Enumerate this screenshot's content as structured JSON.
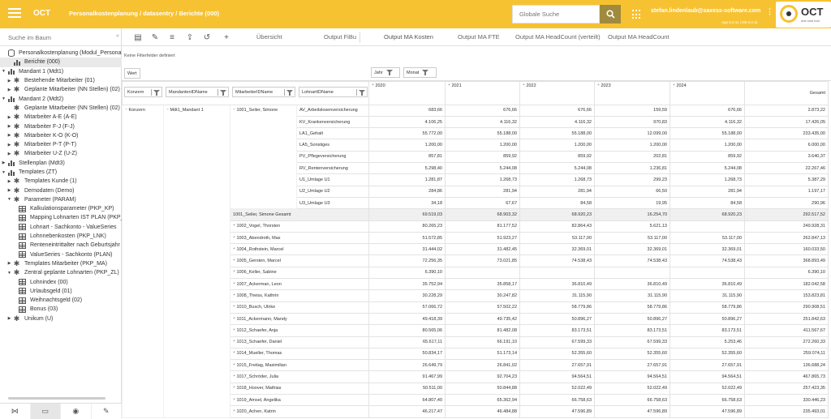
{
  "header": {
    "app_name": "OCT",
    "breadcrumb": "Personalkostenplanung / datasentry / Berichte (000)",
    "search_placeholder": "Globale Suche",
    "user": "stefan.lindenlaub@saxess-software.com",
    "version": "App 5.0.11 | DB 5.0.11",
    "logo_text": "OCT",
    "logo_tagline": "one cool tool",
    "accent_color": "#f7c232"
  },
  "left": {
    "search_placeholder": "Suche im Baum",
    "collapse_icon": "«",
    "tree": [
      {
        "label": "Personalkostenplanung (Modul_Personalkosten)",
        "icon": "database-icon",
        "caret": "",
        "indent": 0
      },
      {
        "label": "Berichte (000)",
        "icon": "bar-chart-icon",
        "caret": "",
        "indent": 1,
        "selected": true
      },
      {
        "label": "Mandant 1 (Mdt1)",
        "icon": "bar-chart-icon",
        "caret": "▼",
        "indent": 0
      },
      {
        "label": "Bestehende Mitarbeiter (01)",
        "icon": "gear-icon",
        "caret": "▶",
        "indent": 1
      },
      {
        "label": "Geplante Mitarbeiter (NN Stellen) (02)",
        "icon": "gear-icon",
        "caret": "▶",
        "indent": 1
      },
      {
        "label": "Mandant 2 (Mdt2)",
        "icon": "bar-chart-icon",
        "caret": "▼",
        "indent": 0
      },
      {
        "label": "Geplante Mitarbeiter (NN Stellen) (02)",
        "icon": "gear-icon",
        "caret": "",
        "indent": 1
      },
      {
        "label": "Mitarbeiter A-E (A-E)",
        "icon": "gear-icon",
        "caret": "▶",
        "indent": 1
      },
      {
        "label": "Mitarbeiter F-J (F-J)",
        "icon": "gear-icon",
        "caret": "▶",
        "indent": 1
      },
      {
        "label": "Mitarbeiter K-O (K-O)",
        "icon": "gear-icon",
        "caret": "▶",
        "indent": 1
      },
      {
        "label": "Mitarbeiter P-T (P-T)",
        "icon": "gear-icon",
        "caret": "▶",
        "indent": 1
      },
      {
        "label": "Mitarbeiter U-Z (U-Z)",
        "icon": "gear-icon",
        "caret": "▶",
        "indent": 1
      },
      {
        "label": "Stellenplan (Mdt3)",
        "icon": "bar-chart-icon",
        "caret": "▶",
        "indent": 0
      },
      {
        "label": "Templates (ZT)",
        "icon": "bar-chart-icon",
        "caret": "▼",
        "indent": 0
      },
      {
        "label": "Templates Kunde (1)",
        "icon": "gear-icon",
        "caret": "▶",
        "indent": 1
      },
      {
        "label": "Demodaten (Demo)",
        "icon": "gear-icon",
        "caret": "▶",
        "indent": 1
      },
      {
        "label": "Parameter (PARAM)",
        "icon": "gear-icon",
        "caret": "▼",
        "indent": 1
      },
      {
        "label": "Kalkulationsparameter (PKP_KP)",
        "icon": "table-icon",
        "caret": "",
        "indent": 2
      },
      {
        "label": "Mapping Lohnarten IST PLAN (PKP_MAP)",
        "icon": "table-icon",
        "caret": "",
        "indent": 2
      },
      {
        "label": "Lohnart - Sachkonto - ValueSeries",
        "icon": "table-icon",
        "caret": "",
        "indent": 2
      },
      {
        "label": "Lohnnebenkosten (PKP_LNK)",
        "icon": "table-icon",
        "caret": "",
        "indent": 2
      },
      {
        "label": "Renteneintrittalter nach Geburtsjahr",
        "icon": "table-icon",
        "caret": "",
        "indent": 2
      },
      {
        "label": "ValueSeries - Sachkonto (PLAN)",
        "icon": "table-icon",
        "caret": "",
        "indent": 2
      },
      {
        "label": "Templates Mitarbeiter (PKP_MA)",
        "icon": "gear-icon",
        "caret": "▶",
        "indent": 1
      },
      {
        "label": "Zentral geplante Lohnarten (PKP_ZL)",
        "icon": "gear-icon",
        "caret": "▼",
        "indent": 1
      },
      {
        "label": "Lohnindex (00)",
        "icon": "table-icon",
        "caret": "",
        "indent": 2
      },
      {
        "label": "Urlaubsgeld (01)",
        "icon": "table-icon",
        "caret": "",
        "indent": 2
      },
      {
        "label": "Weihnachtsgeld (02)",
        "icon": "table-icon",
        "caret": "",
        "indent": 2
      },
      {
        "label": "Bonus (03)",
        "icon": "table-icon",
        "caret": "",
        "indent": 2
      },
      {
        "label": "Unikum (U)",
        "icon": "gear-icon",
        "caret": "▶",
        "indent": 1
      }
    ],
    "bottom_tabs": [
      "share-icon",
      "dashboard-icon",
      "eye-icon",
      "wrench-icon"
    ]
  },
  "toolbar": {
    "tools": [
      "report-icon",
      "wrench-icon",
      "format-icon",
      "export-icon",
      "history-icon",
      "add-icon"
    ],
    "tabs": [
      "Übersicht",
      "Output FiBu",
      "Output MA Kosten",
      "Output MA FTE",
      "Output MA HeadCount (verteilt)",
      "Output MA HeadCount"
    ],
    "active_tab": "Output MA Kosten"
  },
  "filter": {
    "info": "Keine Filterfelder definiert",
    "data_chip": "Wert",
    "column_chips": [
      "Jahr",
      "Monat"
    ],
    "row_chips": [
      "Konzern",
      "MandantenIDName",
      "MitarbeiterIDName",
      "LohnartIDName"
    ]
  },
  "pivot": {
    "columns": [
      "2020",
      "2021",
      "2022",
      "2023",
      "2024",
      "Gesamt"
    ],
    "konzern": "Konzern",
    "mandant": "Mdt1_Mandant 1",
    "first_employee": "1001_Seiler, Simone",
    "detail_rows": [
      {
        "lohnart": "AV_Arbeitslosenversicherung",
        "values": [
          "683,66",
          "676,66",
          "676,66",
          "159,59",
          "676,66",
          "2.873,22"
        ]
      },
      {
        "lohnart": "KV_Krankenversicherung",
        "values": [
          "4.106,25",
          "4.116,32",
          "4.116,32",
          "970,83",
          "4.116,32",
          "17.426,05"
        ]
      },
      {
        "lohnart": "LA1_Gehalt",
        "values": [
          "55.772,00",
          "55.188,00",
          "55.188,00",
          "12.099,00",
          "55.188,00",
          "233.435,00"
        ]
      },
      {
        "lohnart": "LA5_Sonstiges",
        "values": [
          "1.200,00",
          "1.200,00",
          "1.200,00",
          "1.200,00",
          "1.200,00",
          "6.000,00"
        ]
      },
      {
        "lohnart": "PV_Pflegeversicherung",
        "values": [
          "857,81",
          "859,92",
          "859,92",
          "202,81",
          "859,92",
          "3.640,37"
        ]
      },
      {
        "lohnart": "RV_Rentenversicherung",
        "values": [
          "5.298,40",
          "5.244,08",
          "5.244,08",
          "1.236,81",
          "5.244,08",
          "22.267,46"
        ]
      },
      {
        "lohnart": "U1_Umlage U1",
        "values": [
          "1.281,87",
          "1.268,73",
          "1.268,73",
          "299,23",
          "1.268,73",
          "5.387,29"
        ]
      },
      {
        "lohnart": "U2_Umlage U2",
        "values": [
          "284,86",
          "281,94",
          "281,94",
          "66,50",
          "281,94",
          "1.197,17"
        ]
      },
      {
        "lohnart": "U3_Umlage U3",
        "values": [
          "34,18",
          "67,67",
          "84,58",
          "19,95",
          "84,58",
          "290,96"
        ]
      }
    ],
    "subtotal": {
      "label": "1001_Seiler, Simone Gesamt",
      "values": [
        "69.519,03",
        "68.903,32",
        "68.920,23",
        "16.254,70",
        "68.920,23",
        "292.517,52"
      ]
    },
    "employees": [
      {
        "label": "1002_Vogel, Thorsten",
        "values": [
          "80.265,23",
          "81.177,52",
          "82.864,43",
          "5.621,13",
          "",
          "249.928,31"
        ]
      },
      {
        "label": "1003_Abendroth, Max",
        "values": [
          "51.572,85",
          "51.923,27",
          "53.117,00",
          "53.117,00",
          "53.117,00",
          "262.847,13"
        ]
      },
      {
        "label": "1004_Rothstein, Marcel",
        "values": [
          "31.444,02",
          "31.482,45",
          "32.369,01",
          "32.369,01",
          "32.369,01",
          "160.033,50"
        ]
      },
      {
        "label": "1005_Gersten, Marcel",
        "values": [
          "72.256,35",
          "73.021,85",
          "74.538,43",
          "74.538,43",
          "74.538,43",
          "368.893,49"
        ]
      },
      {
        "label": "1006_Keller, Sabine",
        "values": [
          "6.390,10",
          "",
          "",
          "",
          "",
          "6.390,10"
        ]
      },
      {
        "label": "1007_Ackerman, Leon",
        "values": [
          "35.752,94",
          "35.858,17",
          "36.810,49",
          "36.810,49",
          "36.810,49",
          "182.042,58"
        ]
      },
      {
        "label": "1008_Theiss, Kathrin",
        "values": [
          "30.228,29",
          "30.247,82",
          "31.115,90",
          "31.115,90",
          "31.115,90",
          "153.823,81"
        ]
      },
      {
        "label": "1010_Busch, Ulrike",
        "values": [
          "57.066,72",
          "57.502,22",
          "58.779,86",
          "58.779,86",
          "58.779,86",
          "290.908,51"
        ]
      },
      {
        "label": "1011_Ackermann, Mandy",
        "values": [
          "49.418,39",
          "49.735,42",
          "50.896,27",
          "50.896,27",
          "50.896,27",
          "251.842,63"
        ]
      },
      {
        "label": "1012_Schaefer, Anja",
        "values": [
          "80.565,06",
          "81.482,08",
          "83.173,51",
          "83.173,51",
          "83.173,51",
          "411.567,67"
        ]
      },
      {
        "label": "1013_Schaefer, Daniel",
        "values": [
          "65.617,11",
          "66.191,10",
          "67.599,33",
          "67.599,33",
          "5.253,46",
          "272.260,33"
        ]
      },
      {
        "label": "1014_Mueller, Thomas",
        "values": [
          "50.834,17",
          "51.173,14",
          "52.355,60",
          "52.355,60",
          "52.355,60",
          "259.074,11"
        ]
      },
      {
        "label": "1015_Freitag, Maximilian",
        "values": [
          "26.649,79",
          "26.841,02",
          "27.657,91",
          "27.657,91",
          "27.657,91",
          "136.688,24"
        ]
      },
      {
        "label": "1017_Schröder, Julia",
        "values": [
          "91.467,99",
          "92.704,23",
          "94.564,51",
          "94.564,51",
          "94.564,51",
          "467.865,73"
        ]
      },
      {
        "label": "1018_Hoover, Mathias",
        "values": [
          "50.511,00",
          "50.844,88",
          "52.022,49",
          "52.022,49",
          "52.022,49",
          "257.423,35"
        ]
      },
      {
        "label": "1019_Amsel, Angelika",
        "values": [
          "64.807,40",
          "65.362,94",
          "66.758,63",
          "66.758,63",
          "66.758,63",
          "330.446,23"
        ]
      },
      {
        "label": "1020_Achen, Katrin",
        "values": [
          "46.217,47",
          "46.484,88",
          "47.596,89",
          "47.596,89",
          "47.596,89",
          "235.493,01"
        ]
      }
    ]
  }
}
